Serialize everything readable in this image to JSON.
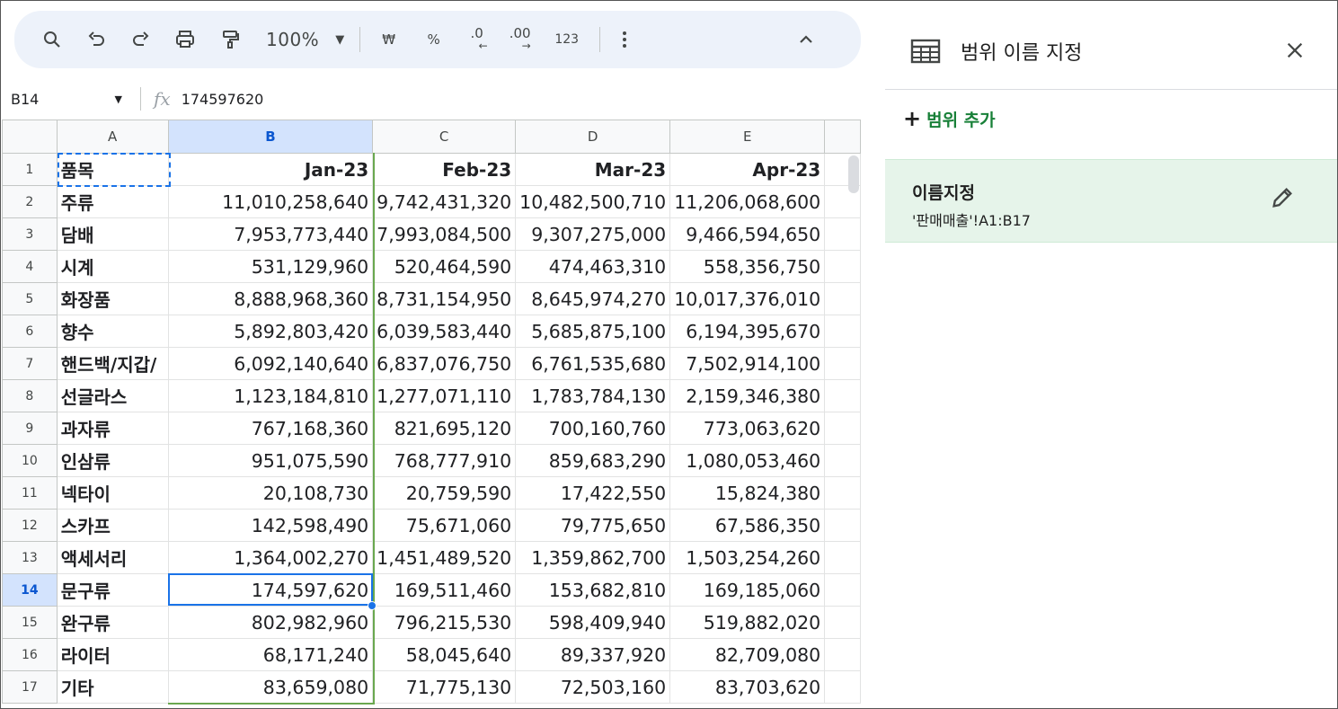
{
  "toolbar": {
    "zoom": "100%",
    "currency": "₩",
    "percent": "%",
    "dec_decrease": ".0",
    "dec_increase": ".00",
    "number_format": "123"
  },
  "formula_bar": {
    "cell_ref": "B14",
    "value": "174597620"
  },
  "grid": {
    "columns": [
      "A",
      "B",
      "C",
      "D",
      "E"
    ],
    "selected_column": "B",
    "selected_row": "14",
    "rows": [
      {
        "num": "1",
        "a": "품목",
        "b": "Jan-23",
        "c": "Feb-23",
        "d": "Mar-23",
        "e": "Apr-23"
      },
      {
        "num": "2",
        "a": "주류",
        "b": "11,010,258,640",
        "c": "9,742,431,320",
        "d": "10,482,500,710",
        "e": "11,206,068,600"
      },
      {
        "num": "3",
        "a": "담배",
        "b": "7,953,773,440",
        "c": "7,993,084,500",
        "d": "9,307,275,000",
        "e": "9,466,594,650"
      },
      {
        "num": "4",
        "a": "시계",
        "b": "531,129,960",
        "c": "520,464,590",
        "d": "474,463,310",
        "e": "558,356,750"
      },
      {
        "num": "5",
        "a": "화장품",
        "b": "8,888,968,360",
        "c": "8,731,154,950",
        "d": "8,645,974,270",
        "e": "10,017,376,010"
      },
      {
        "num": "6",
        "a": "향수",
        "b": "5,892,803,420",
        "c": "6,039,583,440",
        "d": "5,685,875,100",
        "e": "6,194,395,670"
      },
      {
        "num": "7",
        "a": "핸드백/지갑/",
        "b": "6,092,140,640",
        "c": "6,837,076,750",
        "d": "6,761,535,680",
        "e": "7,502,914,100"
      },
      {
        "num": "8",
        "a": "선글라스",
        "b": "1,123,184,810",
        "c": "1,277,071,110",
        "d": "1,783,784,130",
        "e": "2,159,346,380"
      },
      {
        "num": "9",
        "a": "과자류",
        "b": "767,168,360",
        "c": "821,695,120",
        "d": "700,160,760",
        "e": "773,063,620"
      },
      {
        "num": "10",
        "a": "인삼류",
        "b": "951,075,590",
        "c": "768,777,910",
        "d": "859,683,290",
        "e": "1,080,053,460"
      },
      {
        "num": "11",
        "a": "넥타이",
        "b": "20,108,730",
        "c": "20,759,590",
        "d": "17,422,550",
        "e": "15,824,380"
      },
      {
        "num": "12",
        "a": "스카프",
        "b": "142,598,490",
        "c": "75,671,060",
        "d": "79,775,650",
        "e": "67,586,350"
      },
      {
        "num": "13",
        "a": "액세서리",
        "b": "1,364,002,270",
        "c": "1,451,489,520",
        "d": "1,359,862,700",
        "e": "1,503,254,260"
      },
      {
        "num": "14",
        "a": "문구류",
        "b": "174,597,620",
        "c": "169,511,460",
        "d": "153,682,810",
        "e": "169,185,060"
      },
      {
        "num": "15",
        "a": "완구류",
        "b": "802,982,960",
        "c": "796,215,530",
        "d": "598,409,940",
        "e": "519,882,020"
      },
      {
        "num": "16",
        "a": "라이터",
        "b": "68,171,240",
        "c": "58,045,640",
        "d": "89,337,920",
        "e": "82,709,080"
      },
      {
        "num": "17",
        "a": "기타",
        "b": "83,659,080",
        "c": "71,775,130",
        "d": "72,503,160",
        "e": "83,703,620"
      }
    ]
  },
  "panel": {
    "title": "범위 이름 지정",
    "add_range": "범위 추가",
    "named_ranges": [
      {
        "name": "이름지정",
        "range": "'판매매출'!A1:B17"
      }
    ]
  },
  "colors": {
    "accent": "#1a73e8",
    "named_range_green": "#188038",
    "range_border": "#6aa84f",
    "selected_header": "#d3e3fd"
  }
}
